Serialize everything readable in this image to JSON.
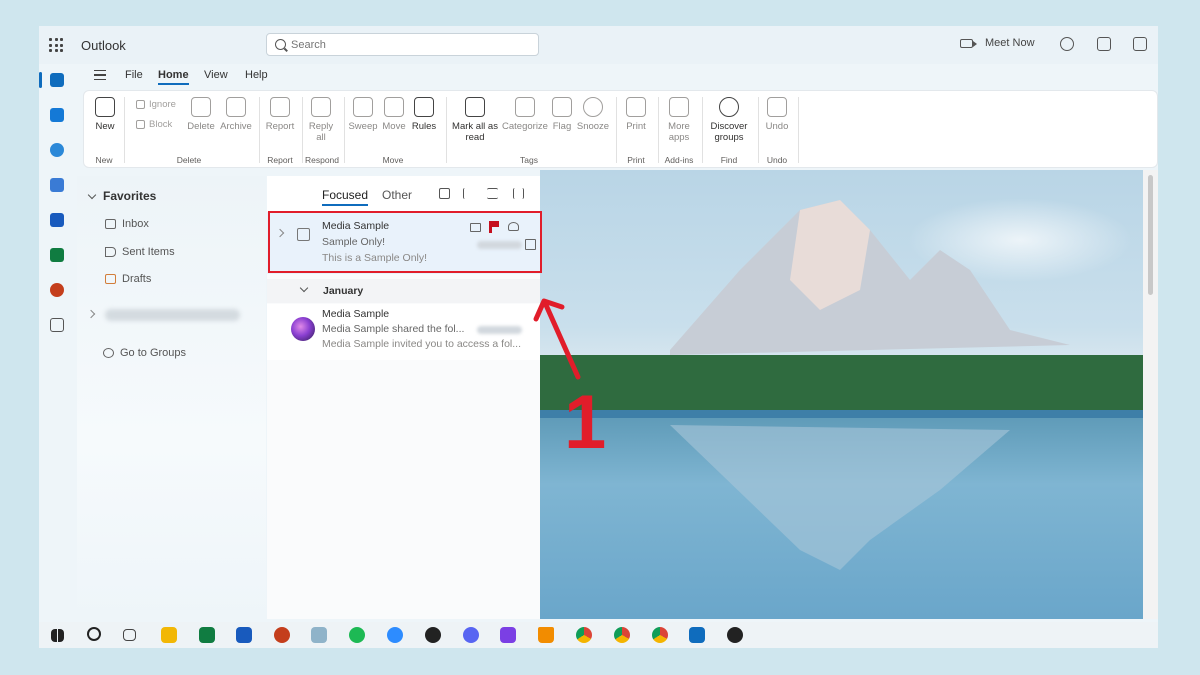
{
  "app": {
    "title": "Outlook"
  },
  "search": {
    "placeholder": "Search"
  },
  "titlebar": {
    "meet_now": "Meet Now"
  },
  "tabs": [
    "File",
    "Home",
    "View",
    "Help"
  ],
  "ribbon": {
    "new": "New",
    "ignore": "Ignore",
    "block": "Block",
    "delete": "Delete",
    "archive": "Archive",
    "report": "Report",
    "reply_all_1": "Reply",
    "reply_all_2": "all",
    "sweep": "Sweep",
    "move": "Move",
    "rules": "Rules",
    "mark_all_read_1": "Mark all as",
    "mark_all_read_2": "read",
    "categorize": "Categorize",
    "flag": "Flag",
    "snooze": "Snooze",
    "print": "Print",
    "more_apps_1": "More",
    "more_apps_2": "apps",
    "discover_groups_1": "Discover",
    "discover_groups_2": "groups",
    "undo": "Undo",
    "groups": {
      "new": "New",
      "delete": "Delete",
      "report": "Report",
      "respond": "Respond",
      "move": "Move",
      "tags": "Tags",
      "print": "Print",
      "addins": "Add-ins",
      "find": "Find",
      "undo": "Undo"
    }
  },
  "folders": {
    "favorites": "Favorites",
    "inbox": "Inbox",
    "sent": "Sent Items",
    "drafts": "Drafts",
    "go_to_groups": "Go to Groups"
  },
  "message_list": {
    "focused": "Focused",
    "other": "Other",
    "selected": {
      "sender": "Media Sample",
      "subject": "Sample Only!",
      "preview": "This is a Sample Only!"
    },
    "section": "January",
    "second": {
      "sender": "Media Sample",
      "subject": "Media Sample shared the fol...",
      "preview": "Media Sample invited you to access a fol..."
    }
  },
  "annotation": {
    "number": "1"
  },
  "colors": {
    "accent": "#0f6cbd",
    "annotation": "#e11d2a",
    "flag": "#c50f1f"
  }
}
